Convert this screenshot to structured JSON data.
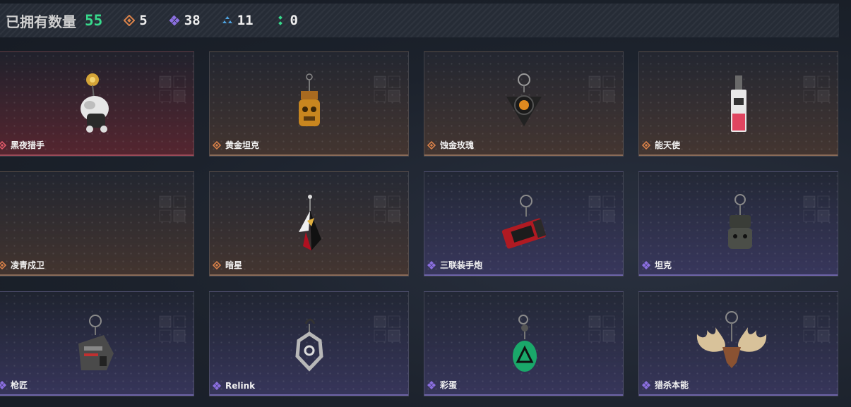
{
  "header": {
    "title": "已拥有数量",
    "total": "55",
    "stats": [
      {
        "icon": "orange-diamond-icon",
        "value": "5"
      },
      {
        "icon": "purple-diamond-icon",
        "value": "38"
      },
      {
        "icon": "blue-triad-icon",
        "value": "11"
      },
      {
        "icon": "green-dots-icon",
        "value": "0"
      }
    ]
  },
  "colors": {
    "total": "#38d98c",
    "orange": "#d9824a",
    "purple": "#8b6fe0",
    "blue": "#4ea2e0",
    "green": "#38d98c"
  },
  "items": [
    {
      "name": "黑夜猎手",
      "rarity": "red"
    },
    {
      "name": "黄金坦克",
      "rarity": "orange"
    },
    {
      "name": "蚀金玫瑰",
      "rarity": "orange"
    },
    {
      "name": "能天使",
      "rarity": "orange"
    },
    {
      "name": "凌青戍卫",
      "rarity": "orange"
    },
    {
      "name": "暗星",
      "rarity": "orange"
    },
    {
      "name": "三联装手炮",
      "rarity": "purple"
    },
    {
      "name": "坦克",
      "rarity": "purple"
    },
    {
      "name": "枪匠",
      "rarity": "purple"
    },
    {
      "name": "Relink",
      "rarity": "purple"
    },
    {
      "name": "彩蛋",
      "rarity": "purple"
    },
    {
      "name": "猎杀本能",
      "rarity": "purple"
    }
  ]
}
